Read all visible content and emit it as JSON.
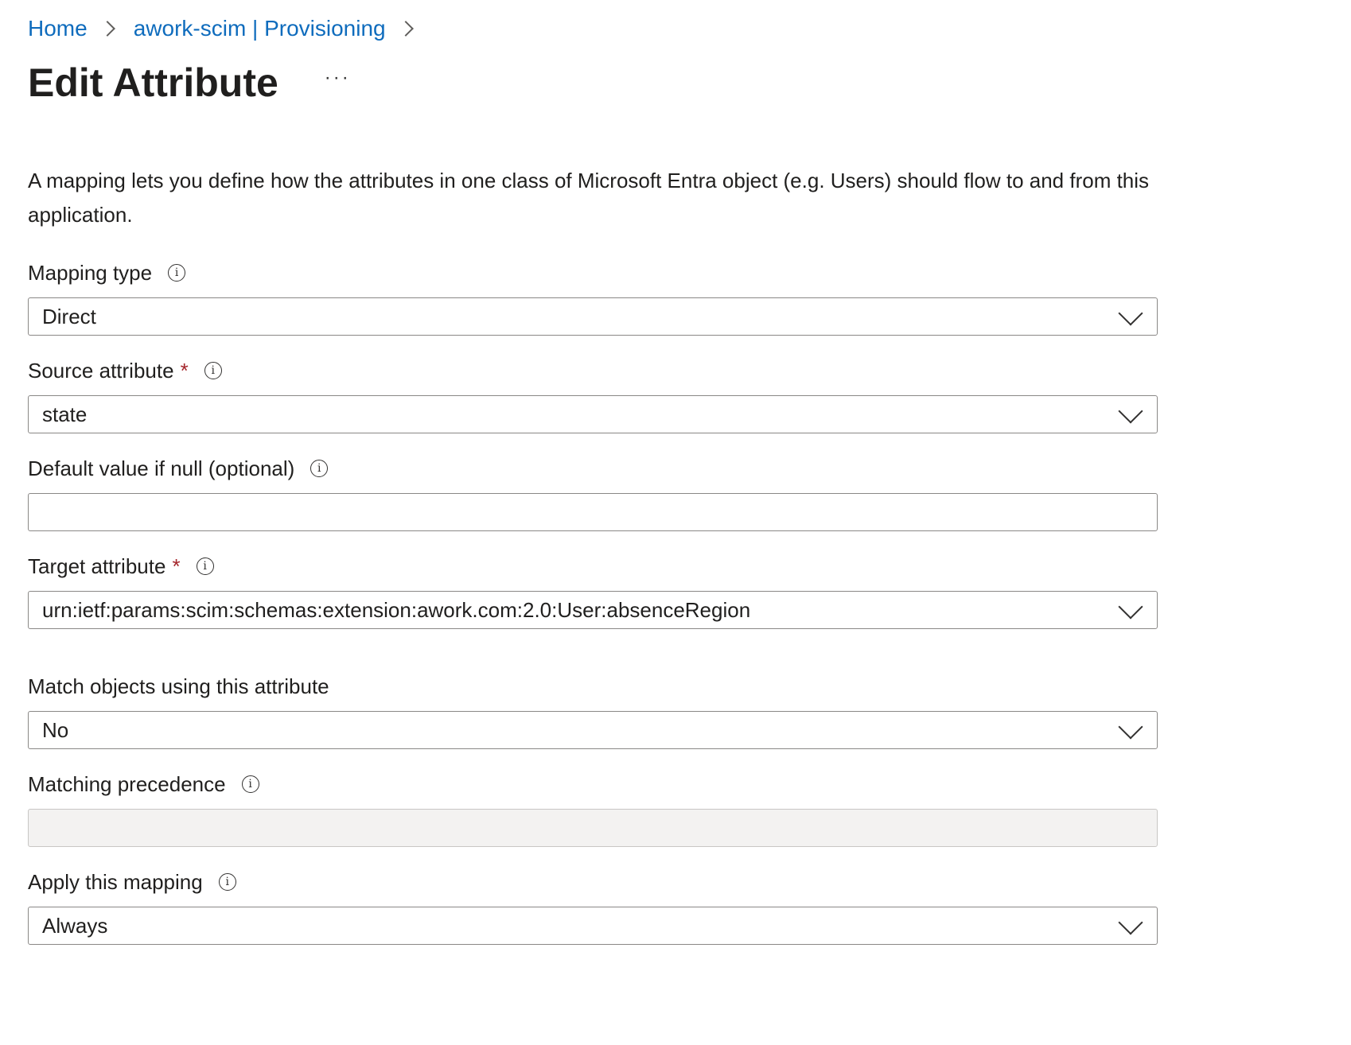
{
  "breadcrumb": {
    "items": [
      "Home",
      "awork-scim | Provisioning"
    ]
  },
  "header": {
    "title": "Edit Attribute",
    "more_label": "···"
  },
  "description": "A mapping lets you define how the attributes in one class of Microsoft Entra object (e.g. Users) should flow to and from this application.",
  "form": {
    "mapping_type": {
      "label": "Mapping type",
      "value": "Direct"
    },
    "source_attribute": {
      "label": "Source attribute",
      "required": "*",
      "value": "state"
    },
    "default_value": {
      "label": "Default value if null (optional)",
      "value": ""
    },
    "target_attribute": {
      "label": "Target attribute",
      "required": "*",
      "value": "urn:ietf:params:scim:schemas:extension:awork.com:2.0:User:absenceRegion"
    },
    "match_objects": {
      "label": "Match objects using this attribute",
      "value": "No"
    },
    "matching_precedence": {
      "label": "Matching precedence",
      "value": ""
    },
    "apply_mapping": {
      "label": "Apply this mapping",
      "value": "Always"
    }
  },
  "icons": {
    "info": "info-icon",
    "chevron": "chevron-down-icon",
    "separator": "chevron-right-icon"
  },
  "colors": {
    "link": "#0f6cbd",
    "required": "#a4262c",
    "border": "#8a8886",
    "disabled_background": "#f3f2f1"
  }
}
